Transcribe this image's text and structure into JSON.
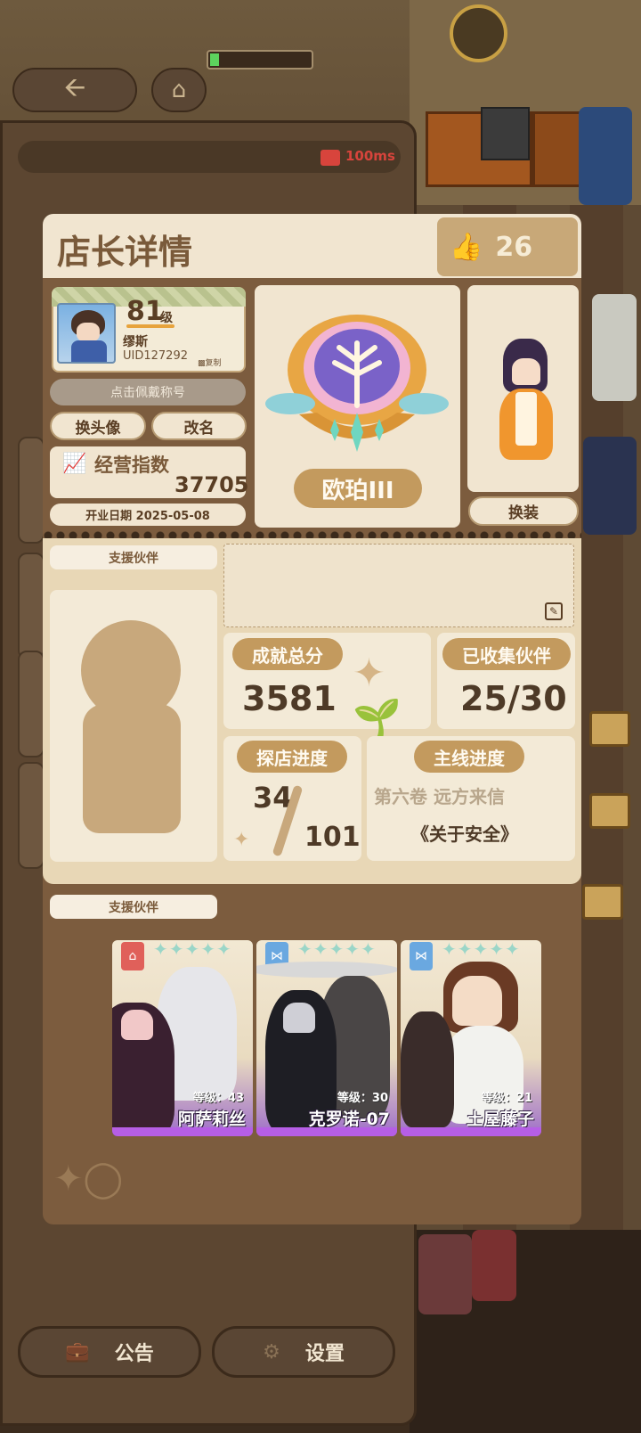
{
  "header": {
    "title": "店长详情",
    "likes": "26"
  },
  "network": {
    "ping": "100ms"
  },
  "profile": {
    "level": "81",
    "level_unit": "级",
    "name": "缪斯",
    "uid": "UID127292",
    "copy_label": "复制",
    "title_button": "点击佩戴称号",
    "change_avatar": "换头像",
    "rename": "改名",
    "index_label": "经营指数",
    "index_value": "37705",
    "open_date": "开业日期 2025-05-08"
  },
  "badge": {
    "rank": "欧珀III"
  },
  "outfit_button": "换装",
  "support": {
    "header": "支援伙伴",
    "team_header": "支援伙伴"
  },
  "stats": {
    "achievement_label": "成就总分",
    "achievement_value": "3581",
    "collected_label": "已收集伙伴",
    "collected_value": "25/30",
    "explore_label": "探店进度",
    "explore_current": "34",
    "explore_total": "101",
    "story_label": "主线进度",
    "story_chapter": "第六卷 远方来信",
    "story_title": "《关于安全》"
  },
  "partners": [
    {
      "name": "阿萨莉丝",
      "level": "等级：43",
      "type_icon": "house-icon",
      "type_color": "#e0605a"
    },
    {
      "name": "克罗诺-07",
      "level": "等级：30",
      "type_icon": "bow-icon",
      "type_color": "#6aa8e0"
    },
    {
      "name": "土屋藤子",
      "level": "等级：21",
      "type_icon": "bow-icon",
      "type_color": "#6aa8e0"
    }
  ],
  "footer": {
    "notice": "公告",
    "settings": "设置"
  }
}
